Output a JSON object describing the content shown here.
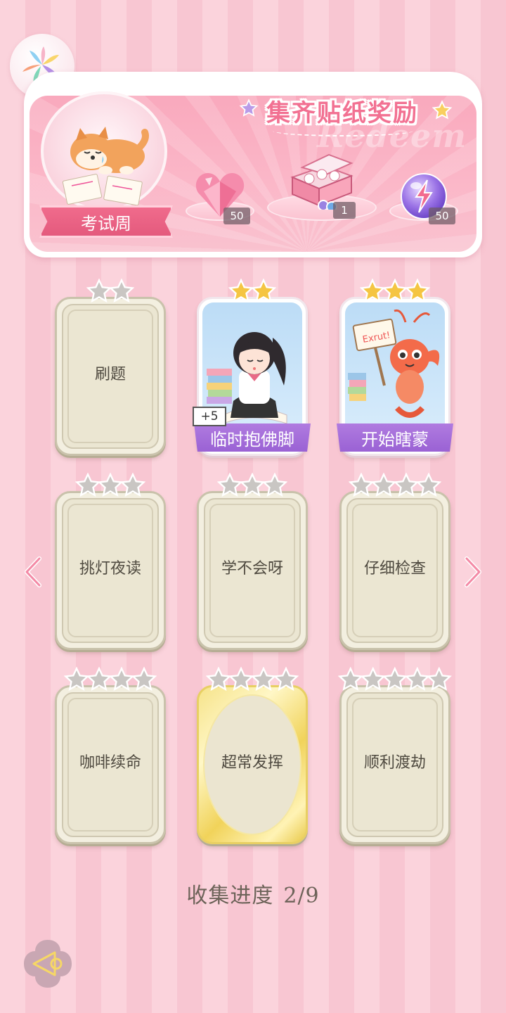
{
  "banner": {
    "title": "集齐贴纸奖励",
    "watermark": "Redeem",
    "theme_label": "考试周",
    "rewards": [
      {
        "icon": "heart-gem-icon",
        "count": "50"
      },
      {
        "icon": "gift-box-icon",
        "count": "1"
      },
      {
        "icon": "lightning-orb-icon",
        "count": "50"
      }
    ]
  },
  "cards": [
    {
      "name": "刷题",
      "stars": 2,
      "state": "locked"
    },
    {
      "name": "临时抱佛脚",
      "stars": 2,
      "state": "owned",
      "badge": "+5"
    },
    {
      "name": "开始瞎蒙",
      "stars": 3,
      "state": "owned",
      "sign_text": "Exrut!"
    },
    {
      "name": "挑灯夜读",
      "stars": 3,
      "state": "locked"
    },
    {
      "name": "学不会呀",
      "stars": 3,
      "state": "locked"
    },
    {
      "name": "仔细检查",
      "stars": 4,
      "state": "locked"
    },
    {
      "name": "咖啡续命",
      "stars": 4,
      "state": "locked"
    },
    {
      "name": "超常发挥",
      "stars": 4,
      "state": "locked-gold"
    },
    {
      "name": "顺利渡劫",
      "stars": 5,
      "state": "locked"
    }
  ],
  "progress": {
    "label": "收集进度",
    "value": "2/9"
  },
  "colors": {
    "accent": "#f27192",
    "ribbon": "#9a62d4",
    "star_gold": "#f5c542",
    "star_gray": "#c9c6c3"
  }
}
